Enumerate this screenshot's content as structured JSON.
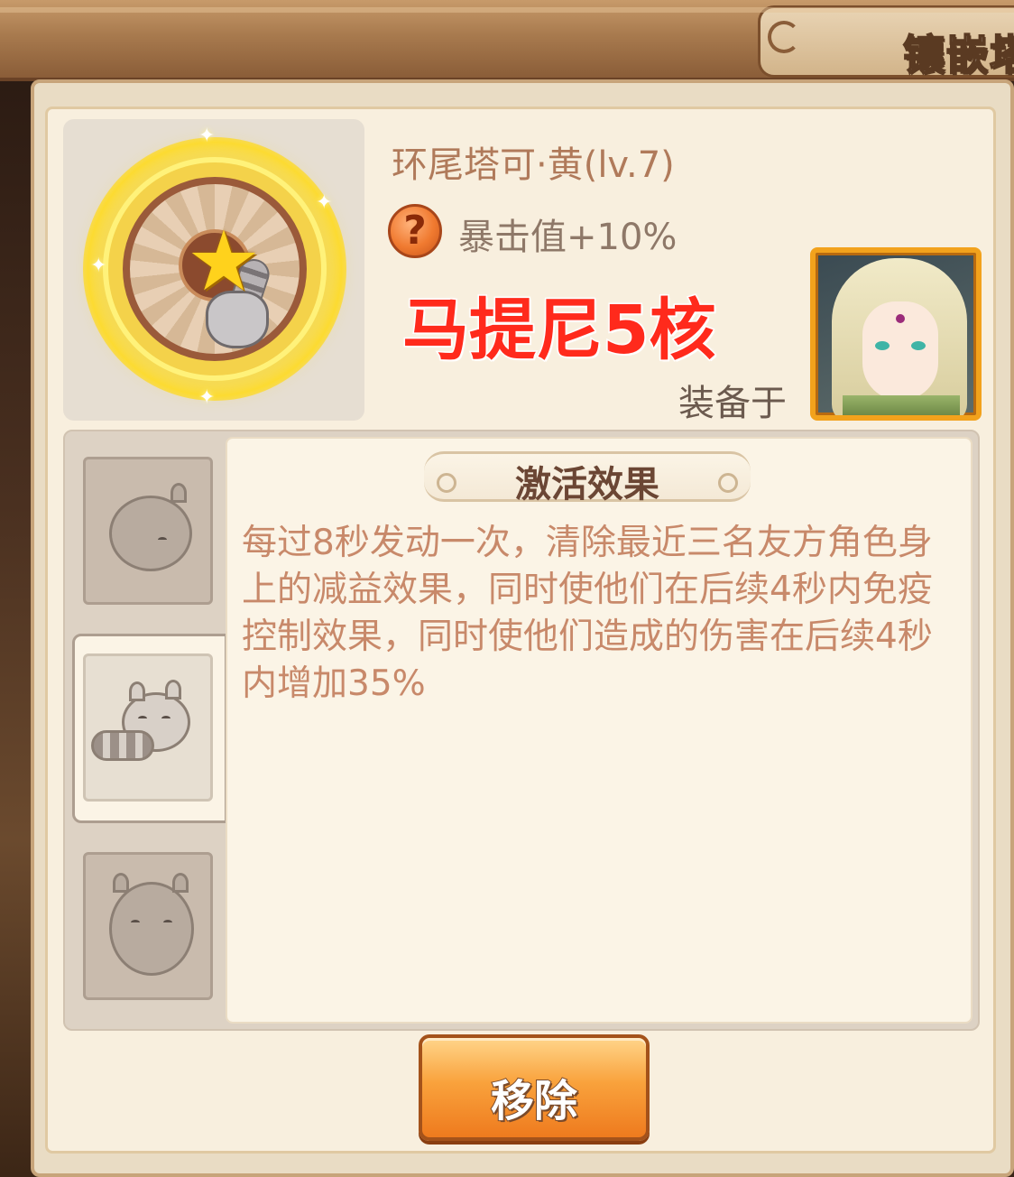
{
  "header": {
    "title": "镶嵌塔"
  },
  "item": {
    "name": "环尾塔可·黄(lv.7)",
    "stat": "暴击值+10%",
    "help_symbol": "?",
    "equipped_label": "装备于",
    "icon": "ring-tailed-core-icon"
  },
  "annotation": {
    "text": "马提尼5核",
    "color": "#ff2a1c"
  },
  "hero": {
    "icon": "hero-portrait"
  },
  "effect": {
    "title": "激活效果",
    "description": "每过8秒发动一次，清除最近三名友方角色身上的减益效果，同时使他们在后续4秒内免疫控制效果，同时使他们造成的伤害在后续4秒内增加35%"
  },
  "side_tabs": [
    {
      "icon": "squirrel-icon",
      "selected": false
    },
    {
      "icon": "raccoon-icon",
      "selected": true
    },
    {
      "icon": "hamster-icon",
      "selected": false
    }
  ],
  "actions": {
    "remove_label": "移除"
  },
  "colors": {
    "accent_orange": "#f9a23c",
    "name_text": "#b07a5a",
    "effect_text": "#c8896a"
  }
}
